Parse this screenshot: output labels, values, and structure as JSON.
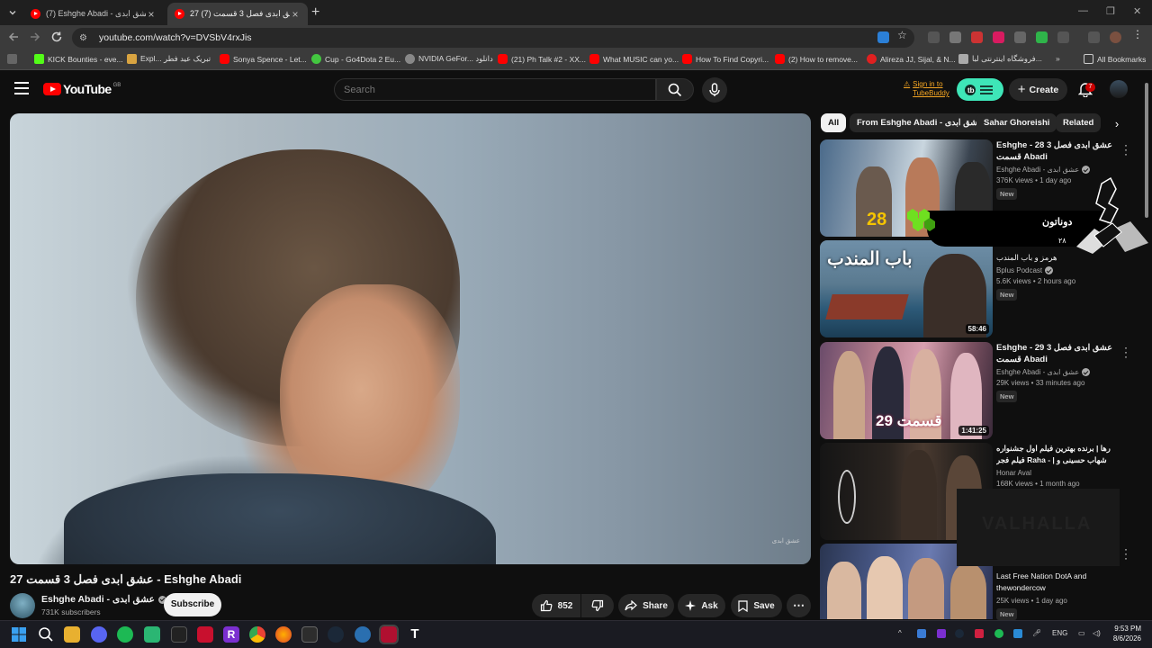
{
  "browser": {
    "tabs": [
      {
        "title": "(7) Eshghe Abadi - عشق ابدی - Y",
        "active": false
      },
      {
        "title": "27 عشق ابدی فصل 3 قسمت (7)",
        "active": true
      }
    ],
    "url": "youtube.com/watch?v=DVSbV4rxJis",
    "bookmarks": [
      "KICK Bounties - eve...",
      "Expl... تبریک عید فطر",
      "Sonya Spence - Let...",
      "Cup - Go4Dota 2 Eu...",
      "NVIDIA GeFor... دانلود",
      "(21) Ph Talk #2 - XX...",
      "What MUSIC can yo...",
      "How To Find Copyri...",
      "(2) How to remove...",
      "Alireza JJ, Sijal, & N...",
      "فروشگاه اینترنتی لبا...",
      "All Bookmarks"
    ]
  },
  "header": {
    "logo": "YouTube",
    "region": "GB",
    "search_placeholder": "Search",
    "tubebuddy": "Sign in to TubeBuddy",
    "create": "Create",
    "notifications": "7"
  },
  "chips": [
    "All",
    "From Eshghe Abadi - عشق ابدی",
    "Sahar Ghoreishi",
    "Related"
  ],
  "video": {
    "title": "27 عشق ابدی فصل 3 قسمت - Eshghe Abadi",
    "channel": "Eshghe Abadi - عشق ابدی",
    "subscribers": "731K subscribers",
    "subscribe": "Subscribe",
    "likes": "852",
    "share": "Share",
    "ask": "Ask",
    "save": "Save"
  },
  "recommendations": [
    {
      "title": "Eshghe - 28 عشق ابدی فصل 3 قسمت Abadi",
      "channel": "Eshghe Abadi - عشق ابدی",
      "verified": true,
      "meta": "376K views • 1 day ago",
      "badge": "New",
      "duration": "",
      "thumb_text": "28"
    },
    {
      "title": "هرمز و باب المندب",
      "channel": "Bplus Podcast",
      "verified": true,
      "meta": "5.6K views • 2 hours ago",
      "badge": "New",
      "duration": "58:46",
      "thumb_text": "باب المندب"
    },
    {
      "title": "Eshghe - 29 عشق ابدی فصل 3 قسمت Abadi",
      "channel": "Eshghe Abadi - عشق ابدی",
      "verified": true,
      "meta": "29K views • 33 minutes ago",
      "badge": "New",
      "duration": "1:41:25",
      "thumb_text": "قسمت 29"
    },
    {
      "title": "رها | برنده بهترین فیلم اول جشنواره فیلم فجر Raha - | شهاب حسینی و غزل شاکری | ...",
      "channel": "Honar Aval",
      "verified": false,
      "meta": "168K views • 1 month ago",
      "badge": "",
      "duration": "",
      "thumb_text": ""
    },
    {
      "title": "Last Free Nation DotA and thewondercow",
      "channel": "",
      "verified": false,
      "meta": "25K views • 1 day ago",
      "badge": "New",
      "duration": "",
      "thumb_text": ""
    }
  ],
  "overlay": {
    "name": "دوناتون",
    "number": "۲۸",
    "patch_text": "VALHALLA"
  },
  "player": {
    "watermark": "عشق ابدی"
  },
  "taskbar": {
    "clock_time": "9:53 PM",
    "clock_date": "8/6/2026",
    "lang": "ENG"
  },
  "colors": {
    "youtube_red": "#ff0000",
    "tubebuddy_green": "#3ee6b8",
    "background": "#0f0f0f"
  }
}
